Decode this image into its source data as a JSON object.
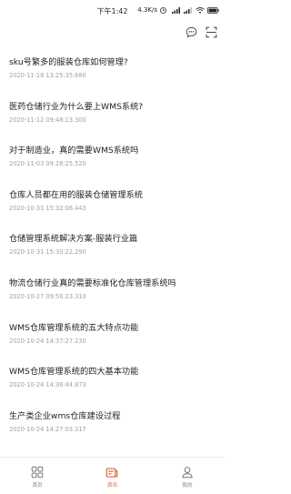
{
  "status_bar": {
    "time": "下午1:42",
    "speed": "4.3K/s"
  },
  "toolbar": {
    "icons": [
      "chat-icon",
      "scan-icon"
    ]
  },
  "articles": [
    {
      "title": "sku号繁多的服装仓库如何管理?",
      "date": "2020-11-18 13:25:35.680"
    },
    {
      "title": "医药仓储行业为什么要上WMS系统?",
      "date": "2020-11-12 09:48:13.300"
    },
    {
      "title": "对于制造业，真的需要WMS系统吗",
      "date": "2020-11-03 09:28:25.520"
    },
    {
      "title": "仓库人员都在用的服装仓储管理系统",
      "date": "2020-10-31 15:32:06.443"
    },
    {
      "title": "仓储管理系统解决方案-服装行业篇",
      "date": "2020-10-31 15:30:22.290"
    },
    {
      "title": "物流仓储行业真的需要标准化仓库管理系统吗",
      "date": "2020-10-27 09:56:23.310"
    },
    {
      "title": "WMS仓库管理系统的五大特点功能",
      "date": "2020-10-24 14:37:27.230"
    },
    {
      "title": "WMS仓库管理系统的四大基本功能",
      "date": "2020-10-24 14:36:44.873"
    },
    {
      "title": "生产类企业wms仓库建设过程",
      "date": "2020-10-24 14:27:03.317"
    }
  ],
  "tabs": [
    {
      "label": "首页",
      "icon": "grid-icon",
      "active": false
    },
    {
      "label": "资讯",
      "icon": "news-icon",
      "active": true
    },
    {
      "label": "我的",
      "icon": "user-icon",
      "active": false
    }
  ],
  "colors": {
    "accent": "#d4572e",
    "inactive": "#888888",
    "date": "#a0a0a0"
  }
}
